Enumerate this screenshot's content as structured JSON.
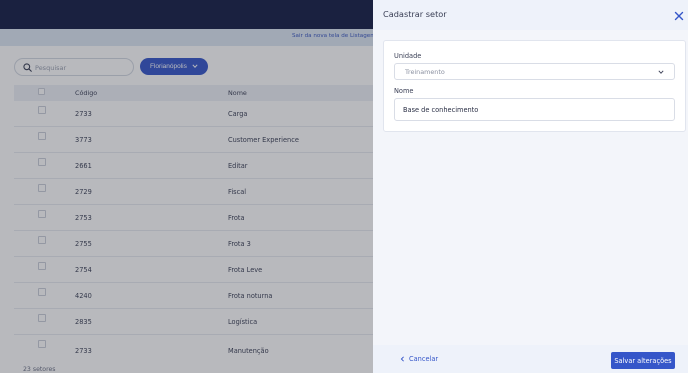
{
  "notice": {
    "text": "Sair da nova tela de Listagem de"
  },
  "search": {
    "placeholder": "Pesquisar"
  },
  "city_filter": {
    "label": "Florianópolis"
  },
  "table": {
    "headers": {
      "code": "Código",
      "name": "Nome"
    },
    "rows": [
      {
        "code": "2733",
        "name": "Carga"
      },
      {
        "code": "3773",
        "name": "Customer Experience"
      },
      {
        "code": "2661",
        "name": "Editar"
      },
      {
        "code": "2729",
        "name": "Fiscal"
      },
      {
        "code": "2753",
        "name": "Frota"
      },
      {
        "code": "2755",
        "name": "Frota 3"
      },
      {
        "code": "2754",
        "name": "Frota Leve"
      },
      {
        "code": "4240",
        "name": "Frota noturna"
      },
      {
        "code": "2835",
        "name": "Logística"
      },
      {
        "code": "2733",
        "name": "Manutenção"
      }
    ]
  },
  "footer": {
    "count": "23 setores"
  },
  "drawer": {
    "title": "Cadastrar setor",
    "unit_label": "Unidade",
    "unit_value": "Treinamento",
    "name_label": "Nome",
    "name_value": "Base de conhecimento",
    "cancel_label": "Cancelar",
    "save_label": "Salvar alterações"
  },
  "colors": {
    "topbar": "#141d45",
    "accent": "#3556c9",
    "drawer_bg": "#f3f5fa"
  },
  "icons": {
    "search": "search-icon",
    "chevron_down": "chevron-down-icon",
    "close": "close-icon",
    "chevron_left": "chevron-left-icon"
  }
}
